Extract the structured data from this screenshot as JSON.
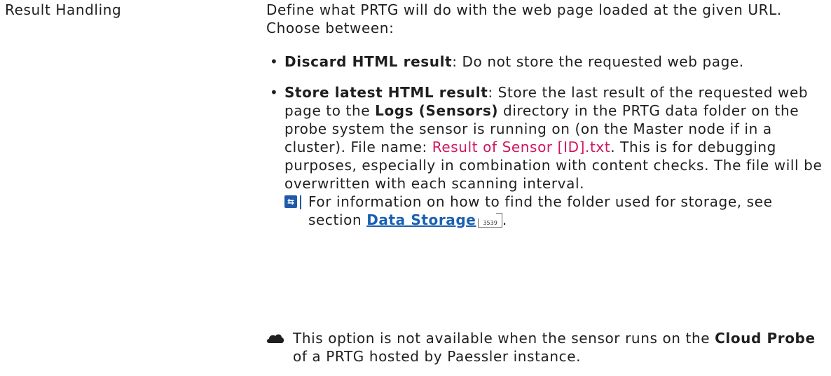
{
  "row": {
    "label": "Result Handling"
  },
  "description": {
    "intro": "Define what PRTG will do with the web page loaded at the given URL. Choose between:"
  },
  "options": [
    {
      "title": "Discard HTML result",
      "text": ": Do not store the requested web page."
    },
    {
      "title": "Store latest HTML result",
      "text_1": ": Store the last result of the requested web page to the ",
      "bold_dir": "Logs (Sensors)",
      "text_2": " directory in the PRTG data folder on the probe system the sensor is running on (on the Master node if in a cluster). File name: ",
      "filename": "Result of Sensor [ID].txt",
      "text_3": ". This is for debugging purposes, especially in combination with content checks. The file will be overwritten with each scanning interval.",
      "note_text": "For information on how to find the folder used for storage, see section ",
      "link_text": "Data Storage",
      "page_ref": "3539",
      "note_end": "."
    }
  ],
  "cloud_note": {
    "text_1": "This option is not available when the sensor runs on the ",
    "bold": "Cloud Probe",
    "text_2": " of a PRTG hosted by Paessler instance."
  },
  "icons": {
    "note": "info-book-icon",
    "cloud": "cloud-icon"
  },
  "colors": {
    "text": "#1f1f1f",
    "filename": "#d0155e",
    "link": "#1a5fb4",
    "note_icon": "#1f5aa8"
  }
}
